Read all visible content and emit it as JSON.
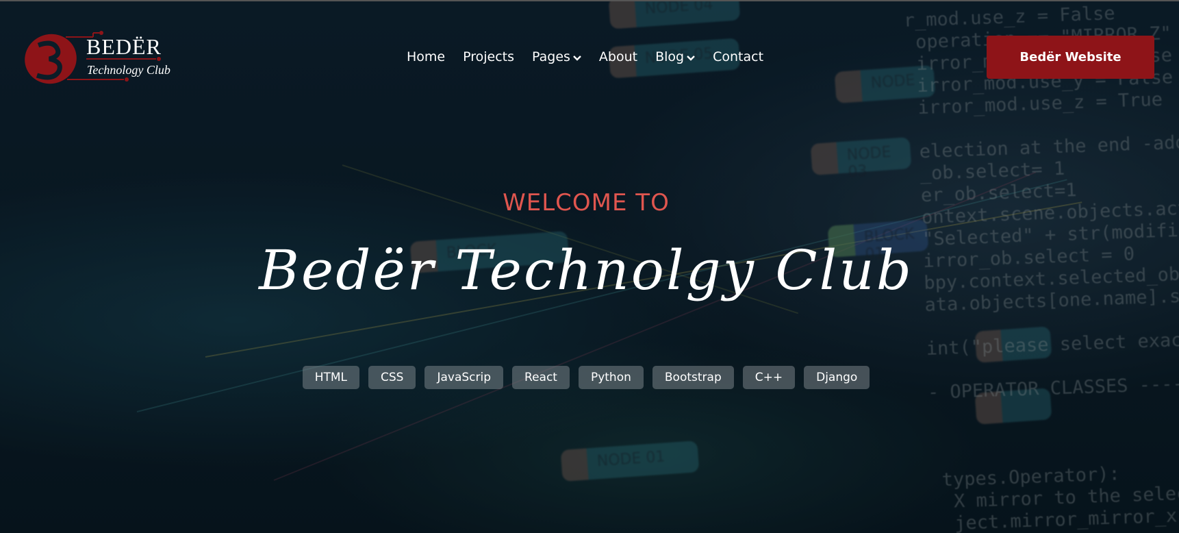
{
  "brand": {
    "name": "BEDËR",
    "subtitle": "Technology Club",
    "color": "#8e1418"
  },
  "nav": {
    "items": [
      {
        "label": "Home",
        "has_dropdown": false
      },
      {
        "label": "Projects",
        "has_dropdown": false
      },
      {
        "label": "Pages",
        "has_dropdown": true
      },
      {
        "label": "About",
        "has_dropdown": false
      },
      {
        "label": "Blog",
        "has_dropdown": true
      },
      {
        "label": "Contact",
        "has_dropdown": false
      }
    ],
    "dropdown_icon": "chevron-down-icon",
    "cta_label": "Bedër Website"
  },
  "hero": {
    "eyebrow": "WELCOME TO",
    "title": "Bedër Technolgy Club",
    "eyebrow_color": "#e0564f",
    "tags": [
      "HTML",
      "CSS",
      "JavaScrip",
      "React",
      "Python",
      "Bootstrap",
      "C++",
      "Django"
    ]
  }
}
